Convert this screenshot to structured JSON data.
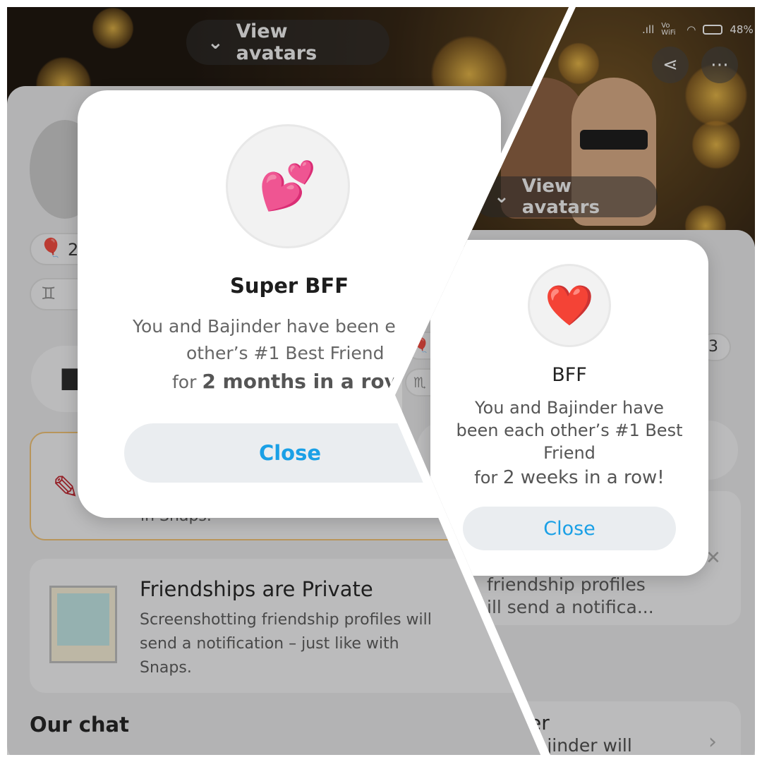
{
  "left": {
    "view_avatars": "View avatars",
    "modal": {
      "emoji": "💕",
      "title": "Super BFF",
      "line1": "You and Bajinder have been e",
      "line2": "other’s #1 Best Friend",
      "line3_prefix": "for ",
      "line3_bold": "2 months in a rov",
      "close": "Close"
    },
    "chip_number": "2",
    "card_behind_text": "in Snaps.",
    "private_card": {
      "title": "Friendships are Private",
      "body": "Screenshotting friendship profiles will send a notification – just like with Snaps."
    },
    "our_chat": "Our chat"
  },
  "right": {
    "status": {
      "signal": ".ıll",
      "vo": "Vo WiFi",
      "battery": "48%"
    },
    "view_avatars": "View avatars",
    "modal": {
      "emoji": "❤️",
      "title": "BFF",
      "line1": "You and Bajinder have",
      "line2": "been each other’s #1 Best",
      "line3": "Friend",
      "line4_prefix": "for ",
      "line4_bold": "2 weeks in a row!",
      "close": "Close"
    },
    "chip_number": "3",
    "card_line1": "friendship profiles",
    "card_line2": "ill send a notifica...",
    "bottom_line1": "er",
    "bottom_line2": "ajinder will"
  },
  "colors": {
    "accent": "#1aa0e6",
    "close_bg": "#eaedf0"
  }
}
